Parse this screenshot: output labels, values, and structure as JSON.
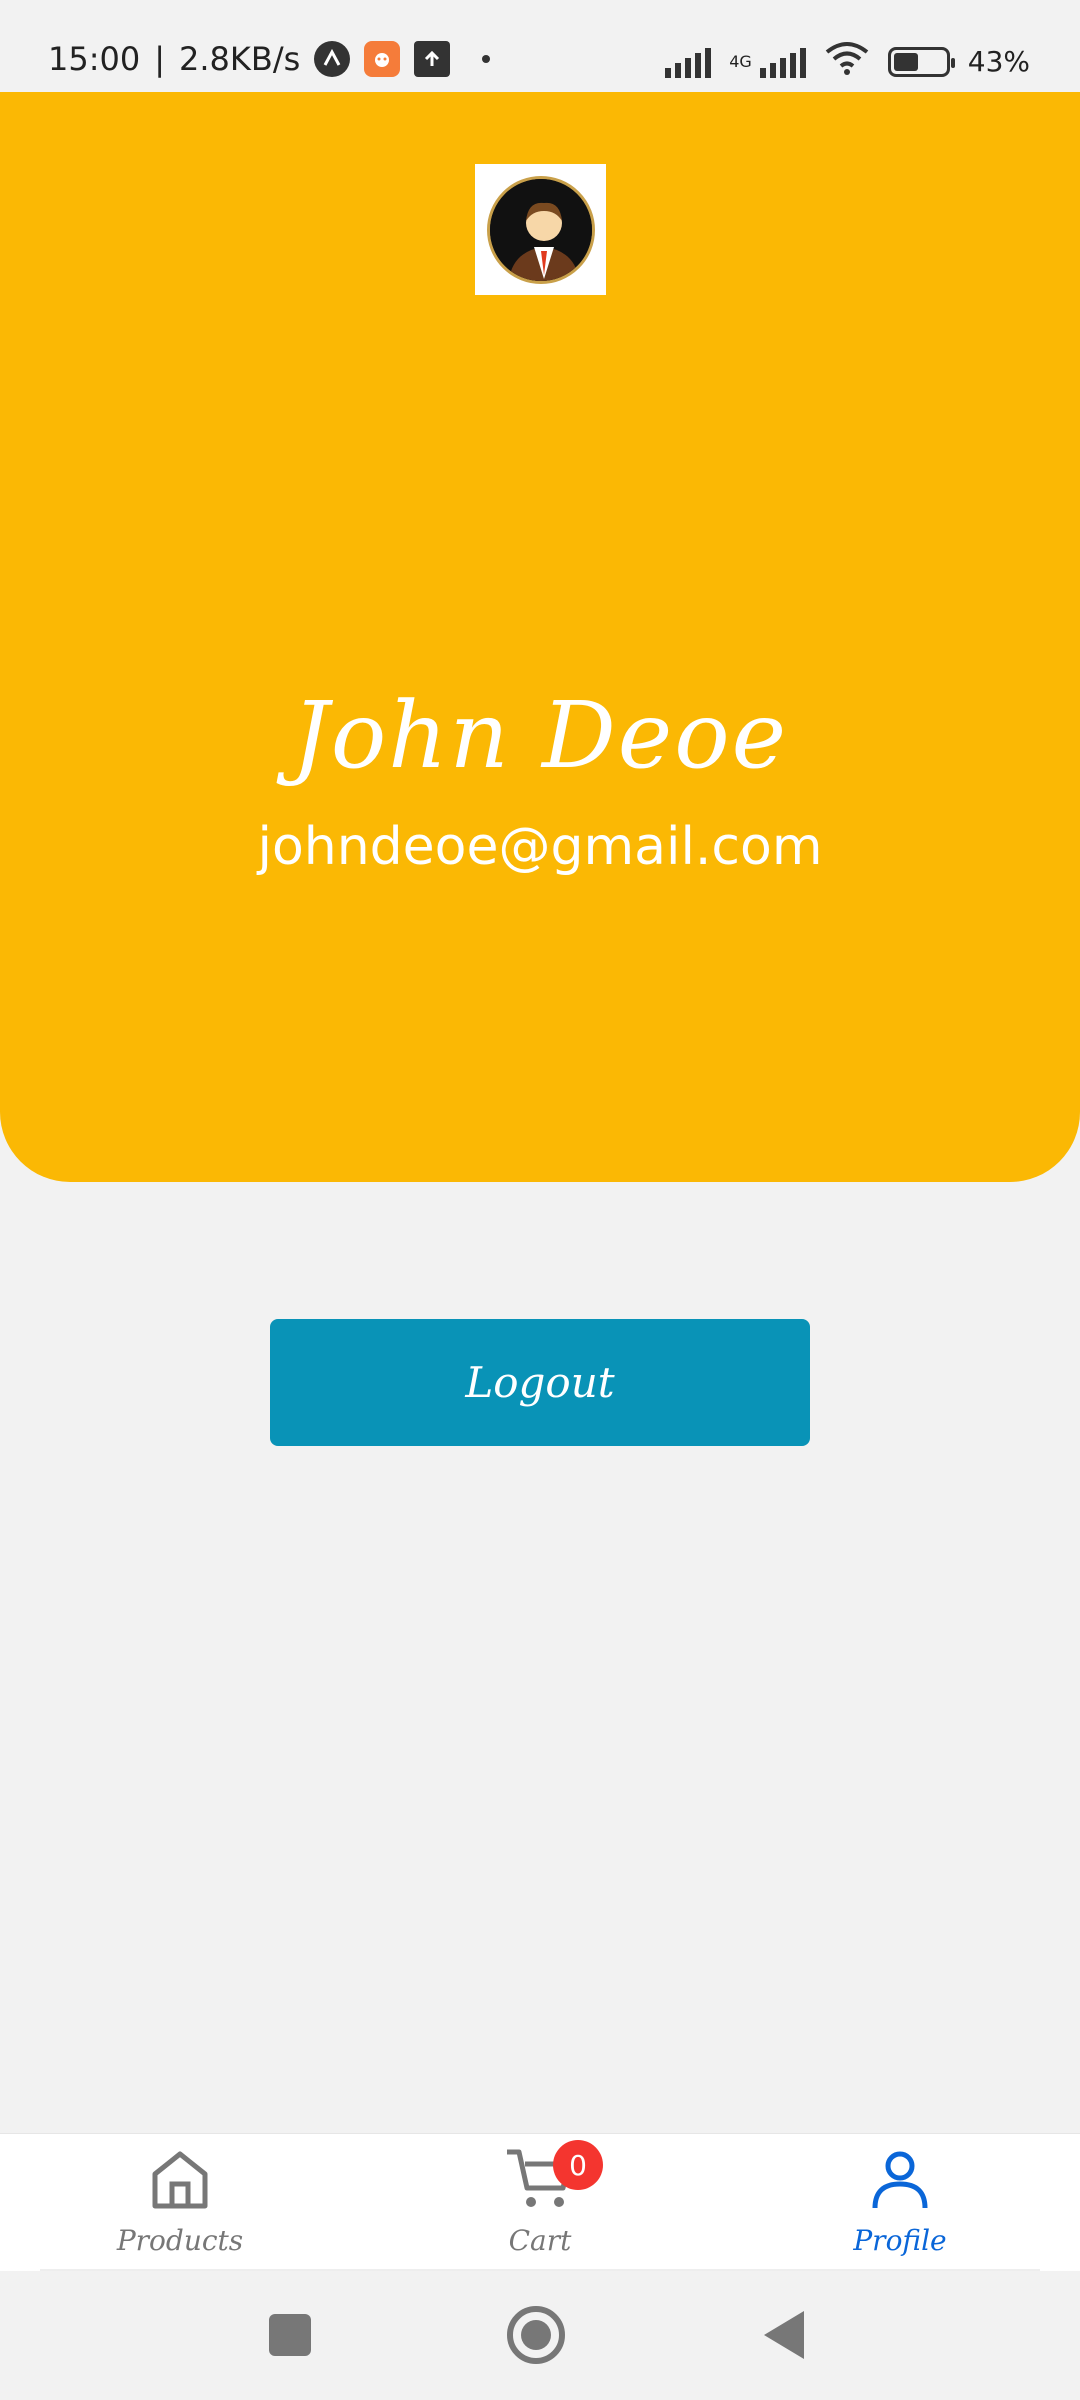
{
  "status_bar": {
    "time": "15:00",
    "separator": "|",
    "network_speed": "2.8KB/s",
    "network_type": "4G",
    "battery_level": "43%",
    "battery_fraction": 0.43,
    "icons": [
      "notification-app-icon",
      "cat-app-icon",
      "upload-icon",
      "signal-icon",
      "signal-4g-icon",
      "wifi-icon",
      "battery-icon"
    ]
  },
  "profile": {
    "name": "John Deoe",
    "email": "johndeoe@gmail.com",
    "header_color": "#fbb804"
  },
  "actions": {
    "logout_label": "Logout",
    "logout_color": "#0993b7"
  },
  "bottom_nav": {
    "items": [
      {
        "label": "Products",
        "icon": "home-icon",
        "active": false
      },
      {
        "label": "Cart",
        "icon": "cart-icon",
        "active": false,
        "badge": "0"
      },
      {
        "label": "Profile",
        "icon": "user-icon",
        "active": true
      }
    ],
    "active_color": "#0a66d8",
    "badge_color": "#f4352f"
  },
  "system_nav": {
    "buttons": [
      "recents-square-icon",
      "home-circle-icon",
      "back-triangle-icon"
    ]
  }
}
